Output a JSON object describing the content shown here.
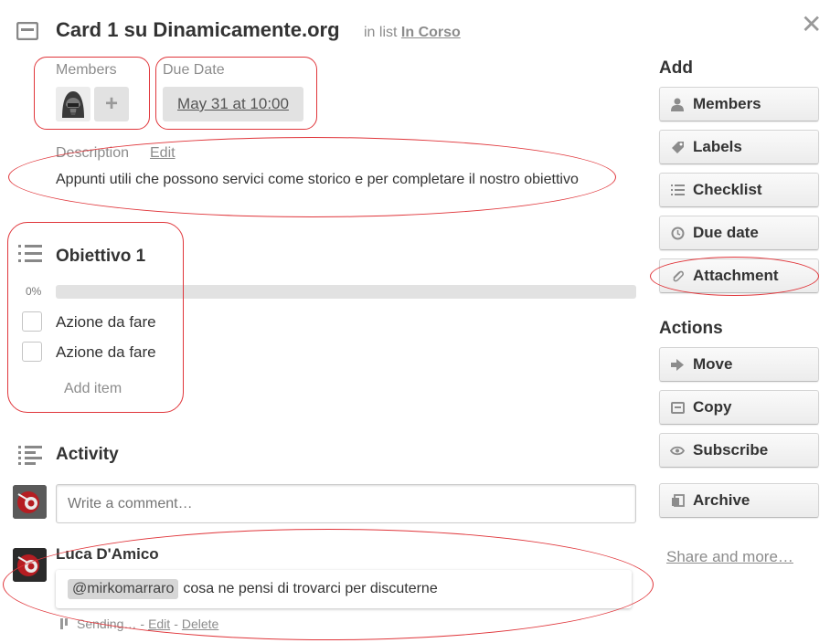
{
  "card": {
    "title": "Card 1 su Dinamicamente.org",
    "in_list_prefix": "in list",
    "list_name": "In Corso",
    "close_symbol": "✕"
  },
  "members": {
    "label": "Members",
    "add_symbol": "+"
  },
  "due_date": {
    "label": "Due Date",
    "value": "May 31 at 10:00"
  },
  "description": {
    "label": "Description",
    "edit_label": "Edit",
    "text": "Appunti utili che possono servici come storico e per completare il nostro obiettivo"
  },
  "checklist": {
    "title": "Obiettivo 1",
    "progress_text": "0%",
    "progress_value": 0,
    "items": [
      {
        "label": "Azione da fare",
        "checked": false
      },
      {
        "label": "Azione da fare",
        "checked": false
      }
    ],
    "add_item_label": "Add item"
  },
  "activity": {
    "title": "Activity",
    "comment_placeholder": "Write a comment…",
    "comments": [
      {
        "author": "Luca D'Amico",
        "mention": "@mirkomarraro",
        "text": "cosa ne pensi di trovarci per discuterne",
        "status": "Sending…",
        "separator": "-",
        "edit_label": "Edit",
        "delete_label": "Delete"
      }
    ]
  },
  "sidebar": {
    "add_heading": "Add",
    "add_buttons": [
      {
        "label": "Members",
        "icon": "person-icon"
      },
      {
        "label": "Labels",
        "icon": "tag-icon"
      },
      {
        "label": "Checklist",
        "icon": "checklist-icon"
      },
      {
        "label": "Due date",
        "icon": "clock-icon"
      },
      {
        "label": "Attachment",
        "icon": "paperclip-icon"
      }
    ],
    "actions_heading": "Actions",
    "action_buttons": [
      {
        "label": "Move",
        "icon": "arrow-right-icon"
      },
      {
        "label": "Copy",
        "icon": "card-icon"
      },
      {
        "label": "Subscribe",
        "icon": "eye-icon"
      },
      {
        "label": "Archive",
        "icon": "archive-icon"
      }
    ],
    "share_label": "Share and more…"
  },
  "colors": {
    "annotation_ring": "#e0363b",
    "muted_text": "#8c8c8c",
    "badge_bg": "#e2e2e2"
  }
}
